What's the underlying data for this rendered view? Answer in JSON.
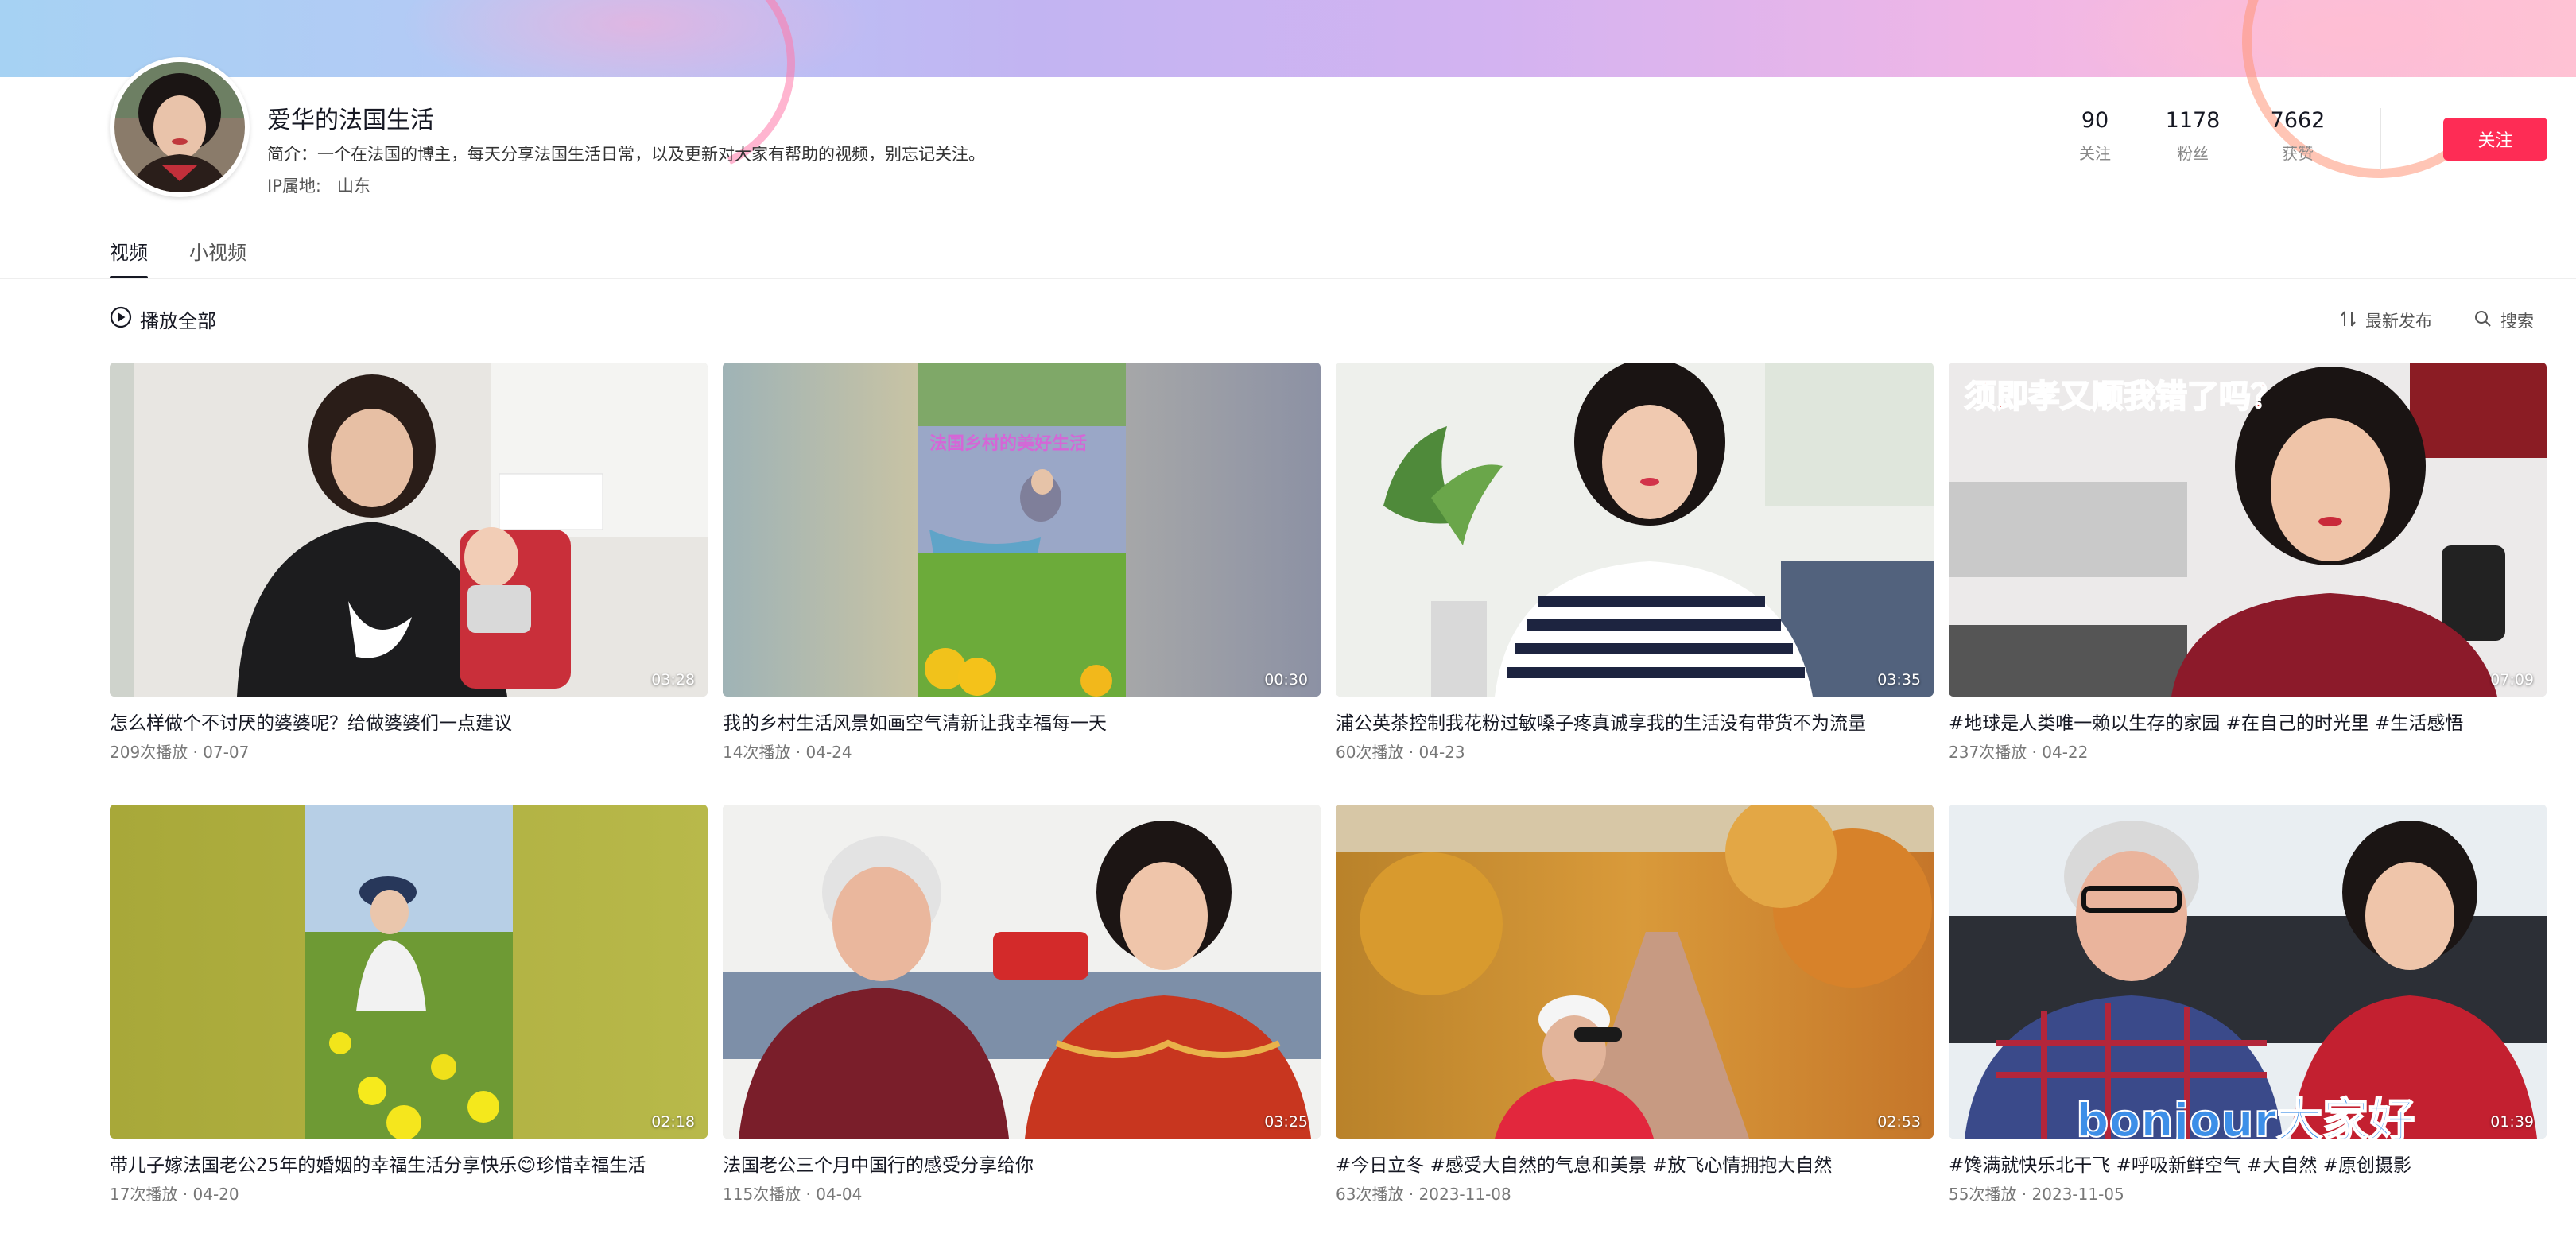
{
  "profile": {
    "name": "爱华的法国生活",
    "intro": "简介：一个在法国的博主，每天分享法国生活日常，以及更新对大家有帮助的视频，别忘记关注。",
    "ip_label": "IP属地:",
    "ip_value": "山东"
  },
  "stats": [
    {
      "value": "90",
      "label": "关注"
    },
    {
      "value": "1178",
      "label": "粉丝"
    },
    {
      "value": "7662",
      "label": "获赞"
    }
  ],
  "follow_label": "关注",
  "tabs": [
    {
      "label": "视频",
      "active": true
    },
    {
      "label": "小视频",
      "active": false
    }
  ],
  "toolbar": {
    "play_all": "播放全部",
    "sort": "最新发布",
    "search": "搜索"
  },
  "videos": [
    {
      "title": "怎么样做个不讨厌的婆婆呢？给做婆婆们一点建议",
      "meta": "209次播放 · 07-07",
      "duration": "03:28"
    },
    {
      "title": "我的乡村生活风景如画空气清新让我幸福每一天",
      "meta": "14次播放 · 04-24",
      "duration": "00:30",
      "overlay": "法国乡村的美好生活"
    },
    {
      "title": "浦公英茶控制我花粉过敏嗓子疼真诚享我的生活没有带货不为流量",
      "meta": "60次播放 · 04-23",
      "duration": "03:35"
    },
    {
      "title": "#地球是人类唯一赖以生存的家园 #在自己的时光里 #生活感悟",
      "meta": "237次播放 · 04-22",
      "duration": "07:09",
      "overlay": "须即孝又顺我错了吗？"
    },
    {
      "title": "带儿子嫁法国老公25年的婚姻的幸福生活分享快乐😊珍惜幸福生活",
      "meta": "17次播放 · 04-20",
      "duration": "02:18"
    },
    {
      "title": "法国老公三个月中国行的感受分享给你",
      "meta": "115次播放 · 04-04",
      "duration": "03:25"
    },
    {
      "title": "#今日立冬 #感受大自然的气息和美景 #放飞心情拥抱大自然",
      "meta": "63次播放 · 2023-11-08",
      "duration": "02:53"
    },
    {
      "title": "#馋满就快乐北干飞 #呼吸新鲜空气 #大自然 #原创摄影",
      "meta": "55次播放 · 2023-11-05",
      "duration": "01:39",
      "overlay": "bonjour大家好"
    }
  ],
  "colors": {
    "accent": "#fe2c55",
    "text": "#161823"
  }
}
